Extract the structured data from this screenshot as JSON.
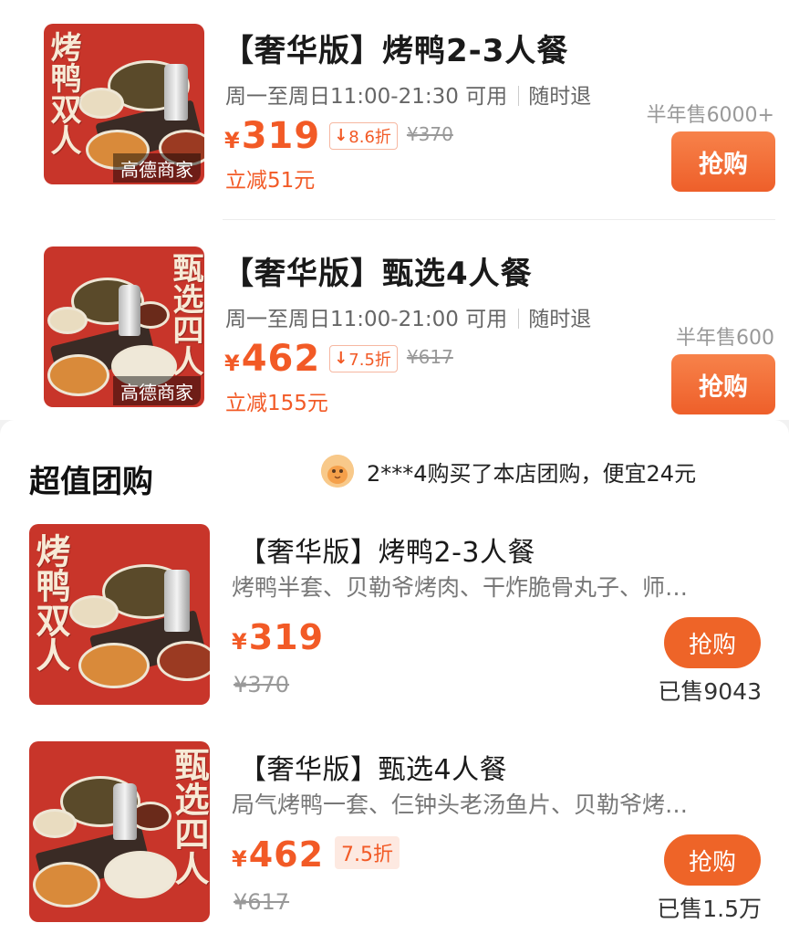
{
  "top_deals": [
    {
      "title": "【奢华版】烤鸭2-3人餐",
      "time": "周一至周日11:00-21:30 可用",
      "refund": "随时退",
      "currency": "¥",
      "price": "319",
      "discount": "8.6折",
      "discount_arrow": "↓",
      "original_price": "¥370",
      "savings": "立减51元",
      "sold": "半年售6000+",
      "buy_label": "抢购",
      "merchant_tag": "高德商家",
      "image_text": "烤鸭双人",
      "image_icon": "roast-duck-set-image"
    },
    {
      "title": "【奢华版】甄选4人餐",
      "time": "周一至周日11:00-21:00 可用",
      "refund": "随时退",
      "currency": "¥",
      "price": "462",
      "discount": "7.5折",
      "discount_arrow": "↓",
      "original_price": "¥617",
      "savings": "立减155元",
      "sold": "半年售600",
      "buy_label": "抢购",
      "merchant_tag": "高德商家",
      "image_text": "甄选四人",
      "image_icon": "four-person-set-image"
    }
  ],
  "group_section": {
    "title": "超值团购",
    "notice": "2***4购买了本店团购，便宜24元",
    "notice_icon": "user-avatar-icon",
    "items": [
      {
        "title": "【奢华版】烤鸭2-3人餐",
        "desc": "烤鸭半套、贝勒爷烤肉、干炸脆骨丸子、师…",
        "currency": "¥",
        "price": "319",
        "discount": "",
        "original_price": "¥370",
        "buy_label": "抢购",
        "sold": "已售9043",
        "image_text": "烤鸭双人",
        "image_icon": "roast-duck-set-image"
      },
      {
        "title": "【奢华版】甄选4人餐",
        "desc": "局气烤鸭一套、仨钟头老汤鱼片、贝勒爷烤…",
        "currency": "¥",
        "price": "462",
        "discount": "7.5折",
        "original_price": "¥617",
        "buy_label": "抢购",
        "sold": "已售1.5万",
        "image_text": "甄选四人",
        "image_icon": "four-person-set-image"
      }
    ]
  },
  "colors": {
    "accent": "#f25a26",
    "button": "#ee6428",
    "image_bg": "#c8352a"
  }
}
